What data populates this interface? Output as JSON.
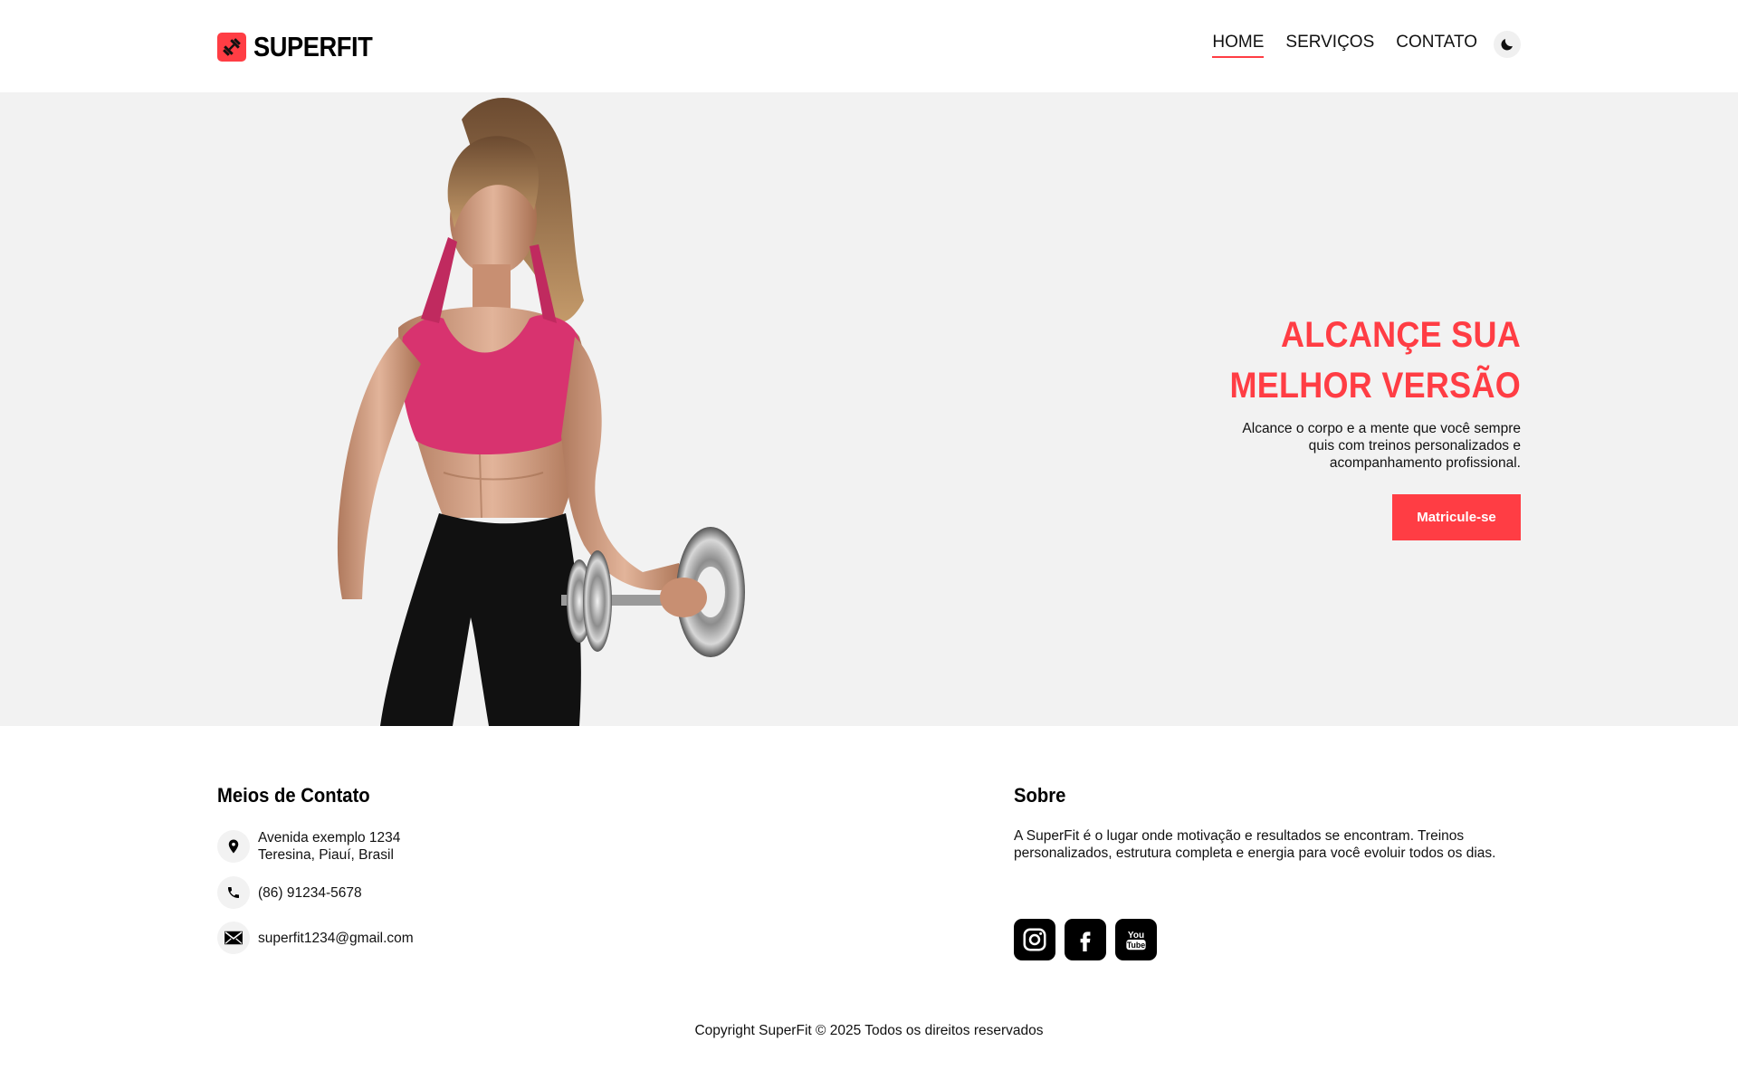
{
  "brand": {
    "name": "SUPERFIT",
    "icon": "dumbbell-icon",
    "accent": "#ff3d44"
  },
  "nav": {
    "items": [
      {
        "label": "HOME",
        "active": true
      },
      {
        "label": "SERVIÇOS",
        "active": false
      },
      {
        "label": "CONTATO",
        "active": false
      }
    ],
    "theme_toggle_icon": "moon-icon"
  },
  "hero": {
    "title_line1": "ALCANÇE SUA",
    "title_line2": "MELHOR VERSÃO",
    "description": "Alcance o corpo e a mente que você sempre quis com treinos personalizados e acompanhamento profissional.",
    "cta_label": "Matricule-se",
    "background": "#f2f2f2"
  },
  "contact": {
    "title": "Meios de Contato",
    "address_line1": "Avenida exemplo 1234",
    "address_line2": "Teresina, Piauí, Brasil",
    "phone": "(86) 91234-5678",
    "email": "superfit1234@gmail.com"
  },
  "about": {
    "title": "Sobre",
    "text": "A SuperFit é o lugar onde motivação e resultados se encontram. Treinos personalizados, estrutura completa e energia para você evoluir todos os dias.",
    "socials": [
      "instagram-icon",
      "facebook-icon",
      "youtube-icon"
    ]
  },
  "copyright": "Copyright SuperFit © 2025 Todos os direitos reservados"
}
